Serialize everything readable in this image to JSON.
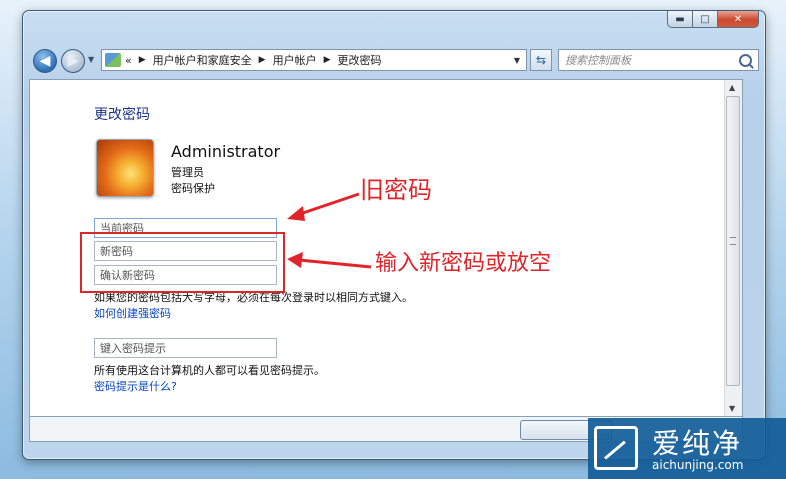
{
  "window": {
    "caption_buttons": {
      "minimize": "▬",
      "maximize": "□",
      "close": "✕"
    }
  },
  "navigation": {
    "back_icon": "arrow-left",
    "forward_icon": "arrow-right",
    "breadcrumb_prefix": "«",
    "breadcrumb": [
      "用户帐户和家庭安全",
      "用户帐户",
      "更改密码"
    ],
    "search_placeholder": "搜索控制面板"
  },
  "page": {
    "title": "更改密码",
    "user": {
      "name": "Administrator",
      "role": "管理员",
      "status": "密码保护"
    },
    "fields": {
      "current_password": "当前密码",
      "new_password": "新密码",
      "confirm_password": "确认新密码",
      "password_hint": "键入密码提示"
    },
    "case_note": "如果您的密码包括大写字母，必须在每次登录时以相同方式键入。",
    "strong_password_link": "如何创建强密码",
    "hint_note": "所有使用这台计算机的人都可以看见密码提示。",
    "hint_link": "密码提示是什么?"
  },
  "annotations": {
    "old_password": "旧密码",
    "new_password": "输入新密码或放空",
    "color": "#e0242a"
  },
  "watermark": {
    "brand_cn": "爱纯净",
    "brand_url": "aichunjing.com"
  }
}
